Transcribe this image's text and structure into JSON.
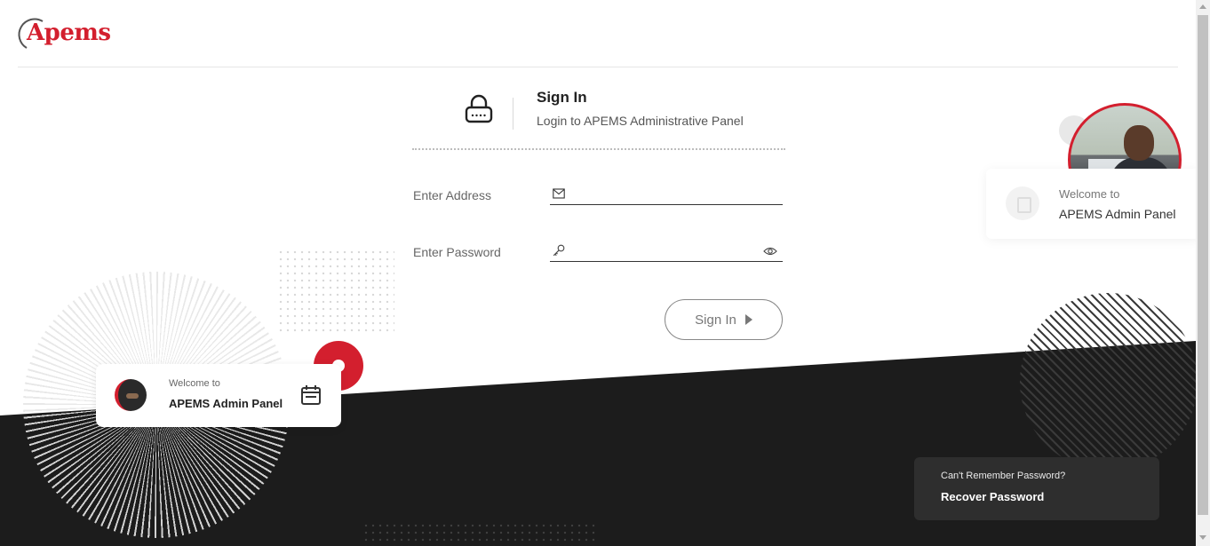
{
  "brand": {
    "logo_text": "Apems",
    "accent_color": "#d31f2e",
    "dark_color": "#1c1c1c"
  },
  "signin": {
    "title": "Sign In",
    "subtitle": "Login to APEMS Administrative Panel",
    "icon": "lock-icon"
  },
  "form": {
    "email_label": "Enter Address",
    "email_value": "",
    "email_icon": "envelope-icon",
    "password_label": "Enter Password",
    "password_value": "",
    "password_icon": "key-icon",
    "password_toggle_icon": "eye-icon",
    "submit_label": "Sign In"
  },
  "welcome_left": {
    "small": "Welcome to",
    "title": "APEMS Admin Panel",
    "icon": "calendar-icon"
  },
  "welcome_right": {
    "small": "Welcome to",
    "title": "APEMS Admin Panel"
  },
  "recover": {
    "question": "Can't Remember Password?",
    "link": "Recover Password"
  }
}
